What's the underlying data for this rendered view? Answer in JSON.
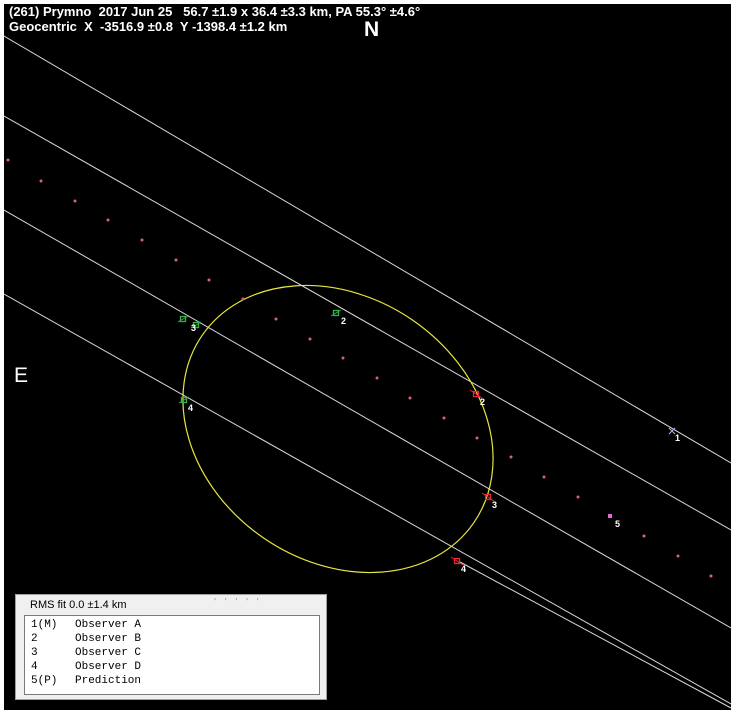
{
  "header": {
    "title": "(261) Prymno  2017 Jun 25   56.7 ±1.9 x 36.4 ±3.3 km, PA 55.3° ±4.6°",
    "geocentric": "Geocentric  X  -3516.9 ±0.8  Y -1398.4 ±1.2 km"
  },
  "compass": {
    "north": "N",
    "east": "E"
  },
  "legend": {
    "rms": "RMS fit  0.0 ±1.4 km",
    "ticks": "' ' ' ' '",
    "items": [
      {
        "code": "1(M)",
        "name": "Observer A"
      },
      {
        "code": "2",
        "name": "Observer B"
      },
      {
        "code": "3",
        "name": "Observer C"
      },
      {
        "code": "4",
        "name": "Observer D"
      },
      {
        "code": "5(P)",
        "name": "Prediction"
      }
    ]
  },
  "chord_labels": [
    "1",
    "2",
    "3",
    "4",
    "5"
  ],
  "colors": {
    "background": "#000000",
    "chord_line": "#d8d8d8",
    "ellipse": "#e6e640",
    "disappear_green": "#2fb44a",
    "reappear_red": "#e8283c",
    "path_dots": "#e0606e",
    "prediction": "#e06ad8"
  }
}
